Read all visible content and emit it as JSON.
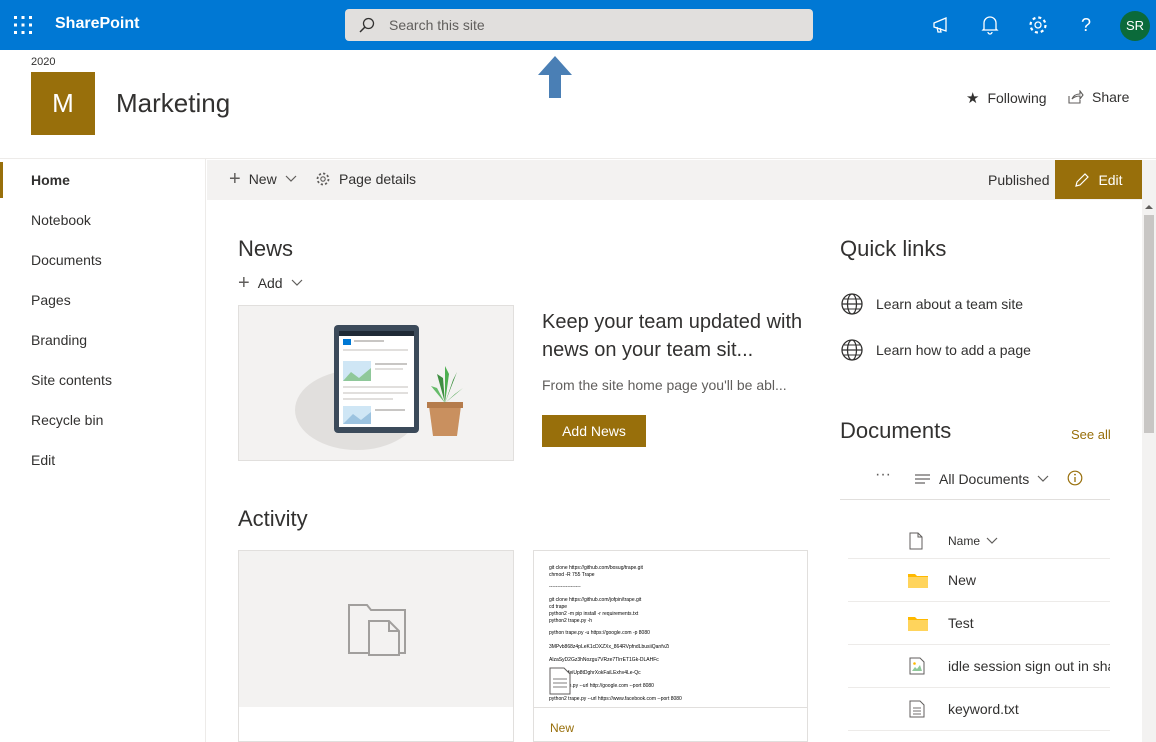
{
  "suite": {
    "brand": "SharePoint",
    "search_placeholder": "Search this site",
    "avatar_initials": "SR"
  },
  "site": {
    "year": "2020",
    "logo_letter": "M",
    "title": "Marketing",
    "following_label": "Following",
    "share_label": "Share"
  },
  "nav": {
    "items": [
      "Home",
      "Notebook",
      "Documents",
      "Pages",
      "Branding",
      "Site contents",
      "Recycle bin",
      "Edit"
    ]
  },
  "commandbar": {
    "new_label": "New",
    "page_details_label": "Page details",
    "status": "Published",
    "edit_label": "Edit"
  },
  "news": {
    "title": "News",
    "add_label": "Add",
    "heading": "Keep your team updated with news on your team sit...",
    "body": "From the site home page you'll be abl...",
    "button": "Add News"
  },
  "activity": {
    "title": "Activity",
    "card2_label": "New",
    "card2_lines": [
      "git clone https://github.com/bosug/trape.git",
      "chmod -R 755 Trape",
      "-------------------",
      "git clone https://github.com/jofpin/trape.git",
      "cd trape",
      "python2 -m pip install -r requirements.txt",
      "python2 trape.py -h",
      "python trape.py -u https://google.com -p 8080",
      "3MPvb868z4pLeK1cDXZXx_864RVpfndLbusiiQanfvZi",
      "AlzaSyD2Gz3hNozgu7VRze7TlrrET1Gk-DLAHFc",
      "22kfeiUp8tDghrXokFaiLExhv4Le-Qc",
      "trape.py --url http://google.com --port 8080",
      "python2 trape.py --url https://www.facebook.com --port 8080"
    ]
  },
  "quicklinks": {
    "title": "Quick links",
    "items": [
      "Learn about a team site",
      "Learn how to add a page"
    ]
  },
  "documents": {
    "title": "Documents",
    "see_all": "See all",
    "view_name": "All Documents",
    "more_label": "···",
    "column_name": "Name",
    "rows": [
      {
        "name": "New",
        "icon": "folder-icon"
      },
      {
        "name": "Test",
        "icon": "folder-icon"
      },
      {
        "name": "idle session sign out in sharepoint",
        "icon": "image-file-icon"
      },
      {
        "name": "keyword.txt",
        "icon": "text-file-icon"
      }
    ]
  },
  "colors": {
    "suite_blue": "#0078d4",
    "accent_gold": "#986f0b",
    "avatar_green": "#0b6a3a"
  }
}
